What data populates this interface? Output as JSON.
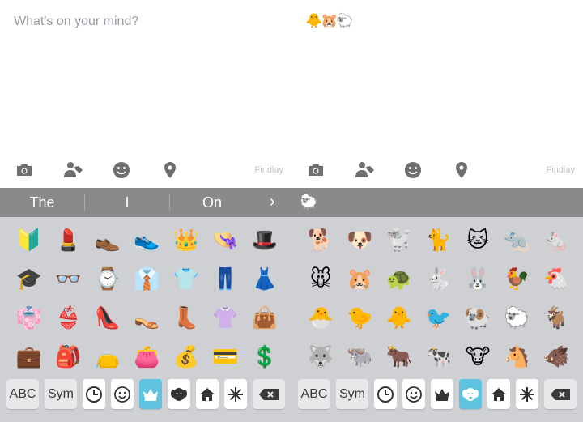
{
  "left": {
    "compose": {
      "placeholder": "What's on your mind?"
    },
    "attach_bar": {
      "icons": [
        "camera-icon",
        "tag-person-icon",
        "smiley-icon",
        "location-pin-icon"
      ],
      "location_text": "Findlay"
    },
    "suggestions": {
      "words": [
        "The",
        "I",
        "On"
      ],
      "more": "›"
    },
    "emoji_rows": [
      [
        "🔰",
        "💄",
        "👞",
        "👟",
        "👑",
        "👒",
        "🎩"
      ],
      [
        "🎓",
        "👓",
        "⌚",
        "👔",
        "👕",
        "👖",
        "👗"
      ],
      [
        "👘",
        "👙",
        "👠",
        "👡",
        "👢",
        "👚",
        "👜"
      ],
      [
        "💼",
        "🎒",
        "👝",
        "👛",
        "💰",
        "💳",
        "💲"
      ]
    ],
    "keyboard": {
      "abc_label": "ABC",
      "sym_label": "Sym",
      "active_category": "crown"
    }
  },
  "right": {
    "compose": {
      "typed_text": "🐥🐹🐑"
    },
    "attach_bar": {
      "icons": [
        "camera-icon",
        "tag-person-icon",
        "smiley-icon",
        "location-pin-icon"
      ],
      "location_text": "Findlay"
    },
    "suggestions": {
      "preview_emoji": "🐑"
    },
    "emoji_rows": [
      [
        "🐕",
        "🐶",
        "🐩",
        "🐈",
        "🐱",
        "🐀",
        "🐁"
      ],
      [
        "🐭",
        "🐹",
        "🐢",
        "🐇",
        "🐰",
        "🐓",
        "🐔"
      ],
      [
        "🐣",
        "🐤",
        "🐥",
        "🐦",
        "🐏",
        "🐑",
        "🐐"
      ],
      [
        "🐺",
        "🐃",
        "🐂",
        "🐄",
        "🐮",
        "🐴",
        "🐗"
      ]
    ],
    "keyboard": {
      "abc_label": "ABC",
      "sym_label": "Sym",
      "active_category": "animals"
    }
  },
  "colors": {
    "suggestion_bar": "#8a8a8c",
    "keyboard_bg": "#cfd0d3",
    "active_key": "#5ec3de",
    "placeholder": "#9a9aa2"
  }
}
